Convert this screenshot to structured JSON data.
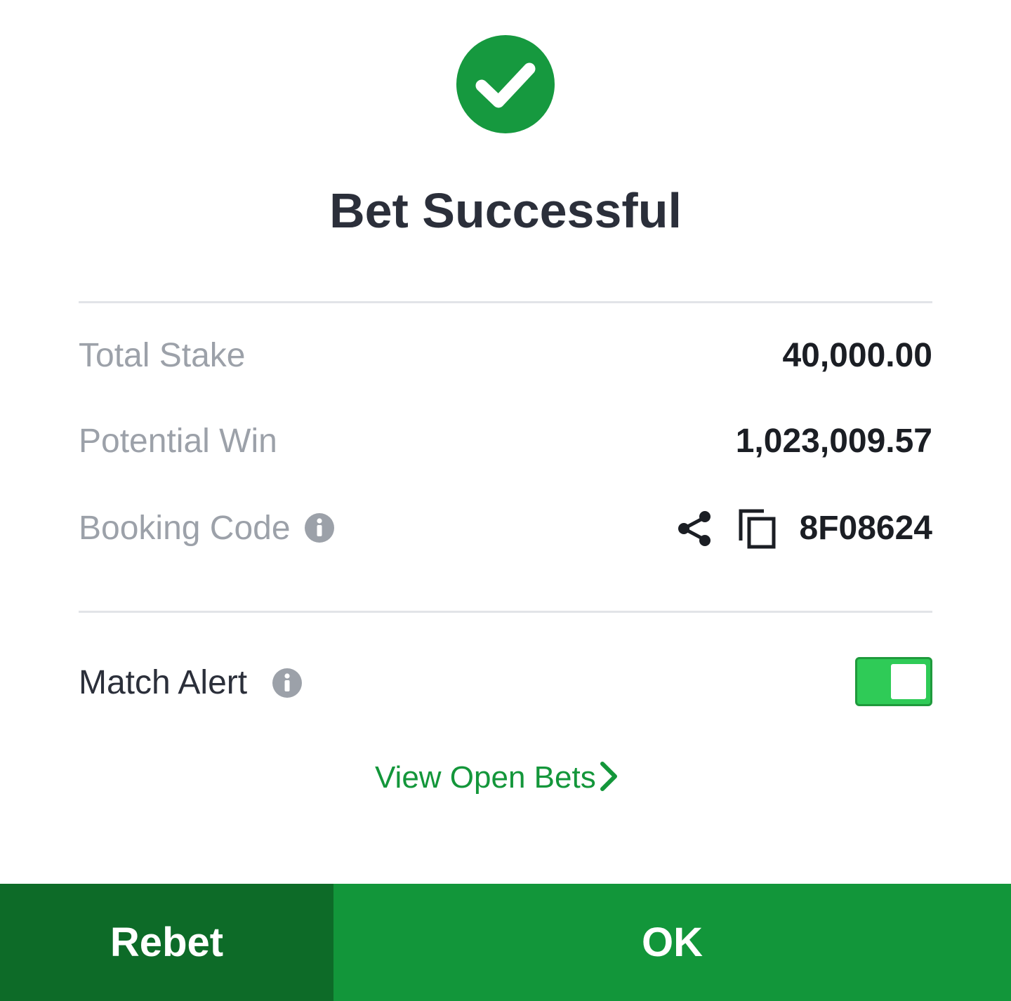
{
  "header": {
    "title": "Bet Successful",
    "status_icon": "check-circle-icon"
  },
  "summary": {
    "total_stake_label": "Total Stake",
    "total_stake_value": "40,000.00",
    "potential_win_label": "Potential Win",
    "potential_win_value": "1,023,009.57",
    "booking_code_label": "Booking Code",
    "booking_code_value": "8F08624",
    "icons": [
      "info-icon",
      "share-icon",
      "copy-icon"
    ]
  },
  "match_alert": {
    "label": "Match Alert",
    "enabled": true
  },
  "links": {
    "view_open_bets": "View Open Bets"
  },
  "footer": {
    "rebet_label": "Rebet",
    "ok_label": "OK"
  },
  "colors": {
    "brand_green": "#12963a",
    "dark_green": "#0d6b28",
    "toggle_green": "#2fcb57",
    "muted_text": "#9ca1a9",
    "primary_text": "#2b2f3a"
  }
}
